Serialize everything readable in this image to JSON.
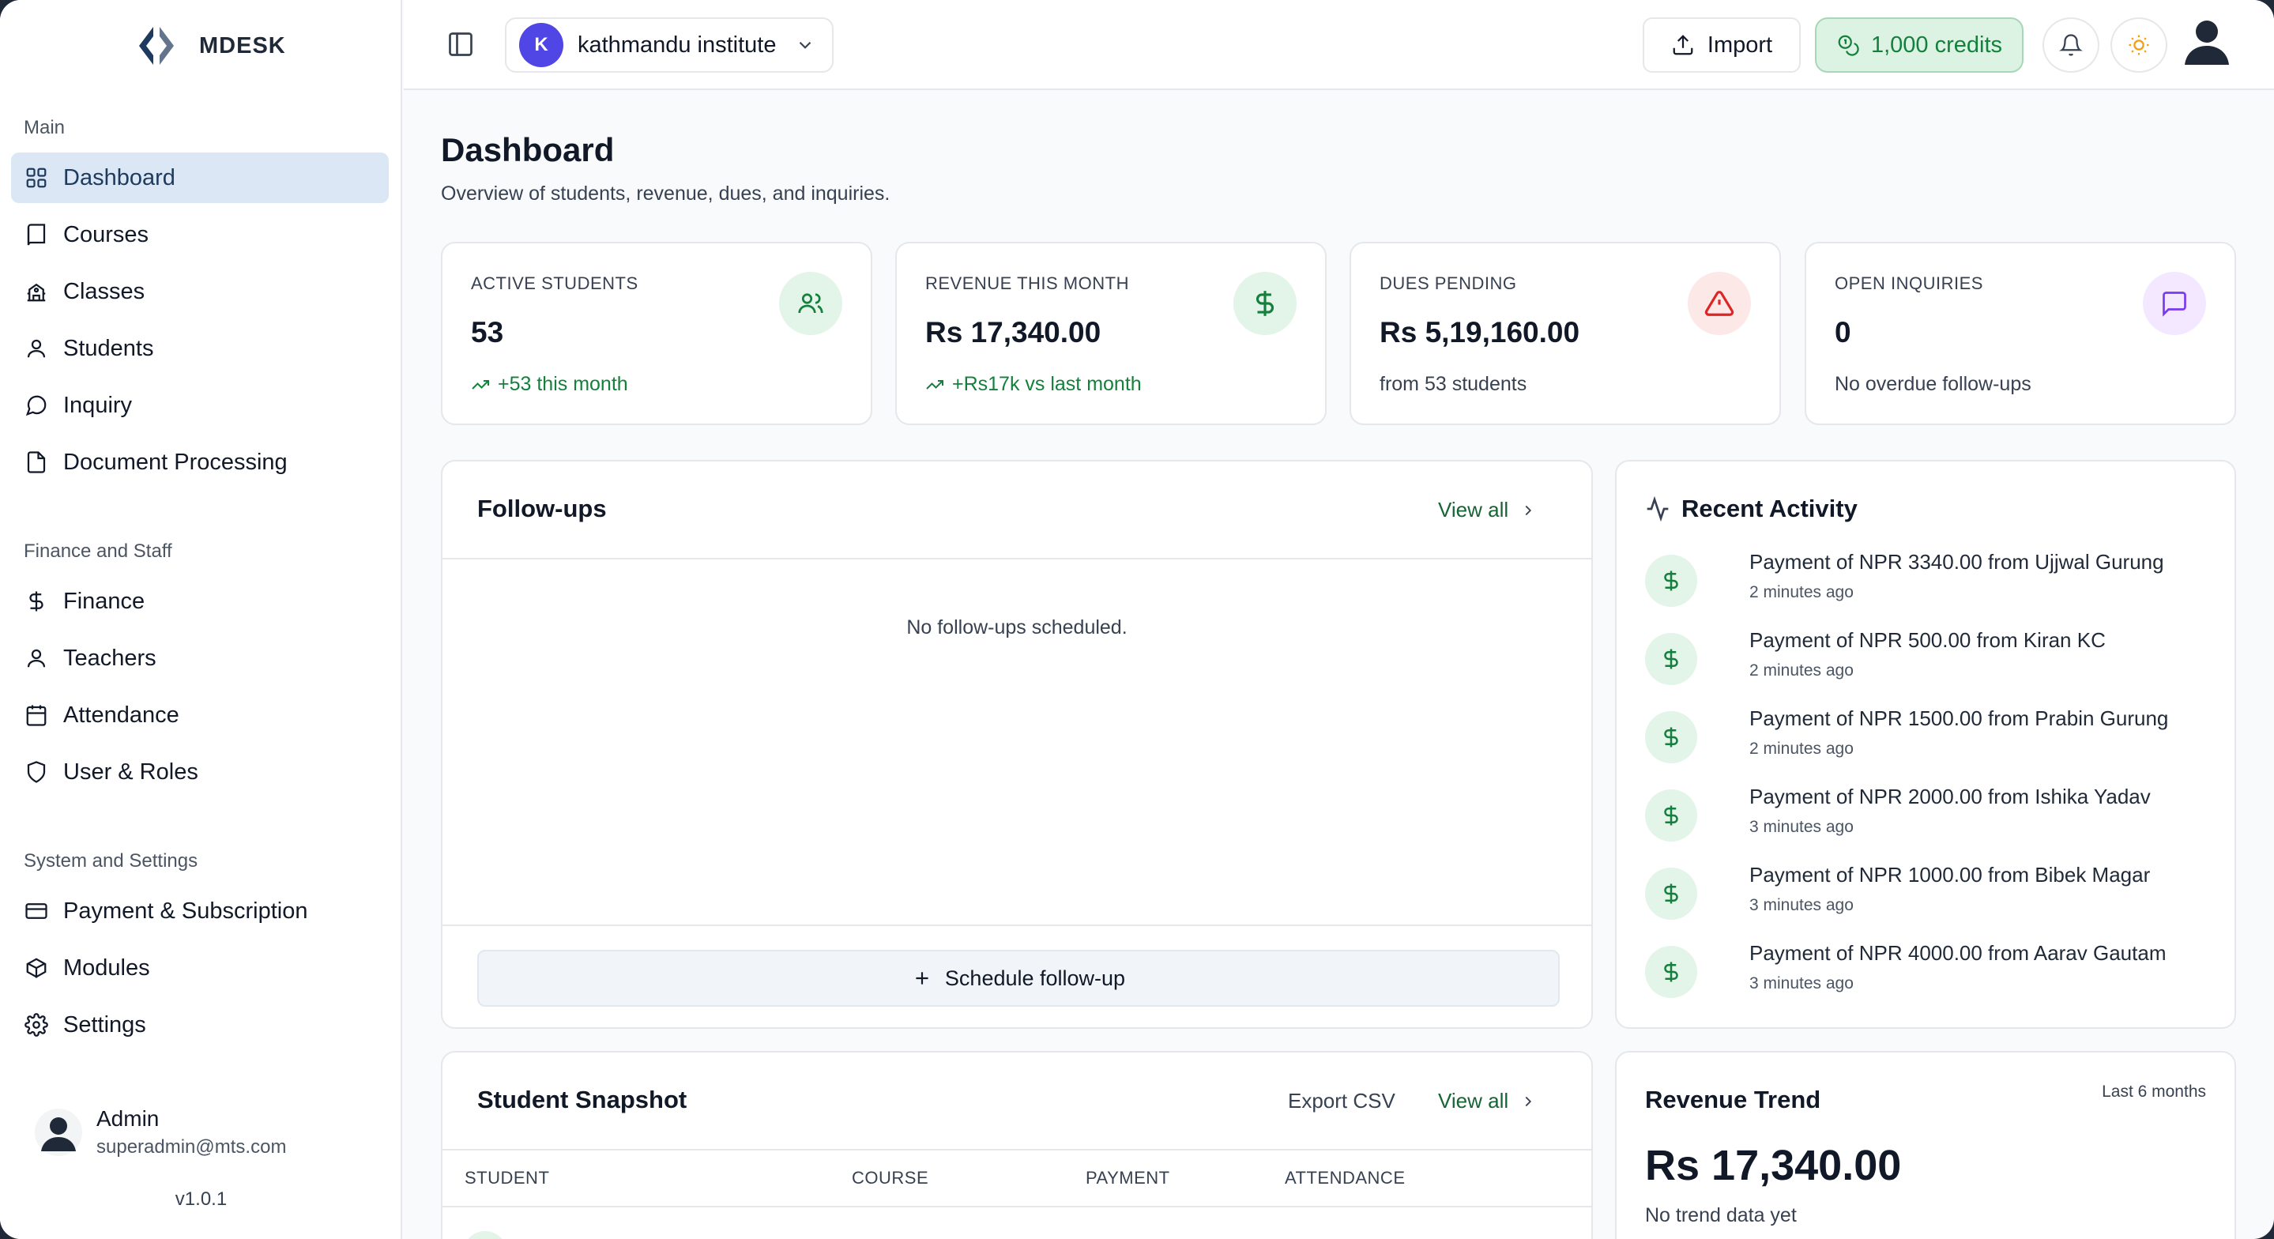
{
  "brand": {
    "name": "MDESK"
  },
  "sidebar": {
    "sections": [
      {
        "label": "Main",
        "items": [
          "Dashboard",
          "Courses",
          "Classes",
          "Students",
          "Inquiry",
          "Document Processing"
        ]
      },
      {
        "label": "Finance and Staff",
        "items": [
          "Finance",
          "Teachers",
          "Attendance",
          "User & Roles"
        ]
      },
      {
        "label": "System and Settings",
        "items": [
          "Payment & Subscription",
          "Modules",
          "Settings"
        ]
      }
    ],
    "active_item": "Dashboard",
    "user": {
      "name": "Admin",
      "email": "superadmin@mts.com"
    },
    "version": "v1.0.1"
  },
  "topbar": {
    "org_initial": "K",
    "org_name": "kathmandu institute",
    "import_label": "Import",
    "credits_label": "1,000 credits"
  },
  "page": {
    "title": "Dashboard",
    "subtitle": "Overview of students, revenue, dues, and inquiries."
  },
  "stats": [
    {
      "label": "ACTIVE STUDENTS",
      "value": "53",
      "sub": "+53 this month",
      "trend": true
    },
    {
      "label": "REVENUE THIS MONTH",
      "value": "Rs 17,340.00",
      "sub": "+Rs17k vs last month",
      "trend": true
    },
    {
      "label": "DUES PENDING",
      "value": "Rs 5,19,160.00",
      "sub": "from 53 students",
      "trend": false
    },
    {
      "label": "OPEN INQUIRIES",
      "value": "0",
      "sub": "No overdue follow-ups",
      "trend": false
    }
  ],
  "followups": {
    "title": "Follow-ups",
    "view_all": "View all",
    "empty": "No follow-ups scheduled.",
    "button": "Schedule follow-up"
  },
  "activity": {
    "title": "Recent Activity",
    "items": [
      {
        "text": "Payment of NPR 3340.00 from Ujjwal Gurung",
        "time": "2 minutes ago"
      },
      {
        "text": "Payment of NPR 500.00 from Kiran KC",
        "time": "2 minutes ago"
      },
      {
        "text": "Payment of NPR 1500.00 from Prabin Gurung",
        "time": "2 minutes ago"
      },
      {
        "text": "Payment of NPR 2000.00 from Ishika Yadav",
        "time": "3 minutes ago"
      },
      {
        "text": "Payment of NPR 1000.00 from Bibek Magar",
        "time": "3 minutes ago"
      },
      {
        "text": "Payment of NPR 4000.00 from Aarav Gautam",
        "time": "3 minutes ago"
      }
    ]
  },
  "snapshot": {
    "title": "Student Snapshot",
    "export": "Export CSV",
    "view_all": "View all",
    "columns": [
      "STUDENT",
      "COURSE",
      "PAYMENT",
      "ATTENDANCE"
    ]
  },
  "trend": {
    "title": "Revenue Trend",
    "range": "Last 6 months",
    "value": "Rs 17,340.00",
    "note": "No trend data yet"
  },
  "colors": {
    "accent_green": "#15803d",
    "active_nav_bg": "#dbe7f5",
    "danger": "#dc2626",
    "purple": "#7c3aed"
  }
}
